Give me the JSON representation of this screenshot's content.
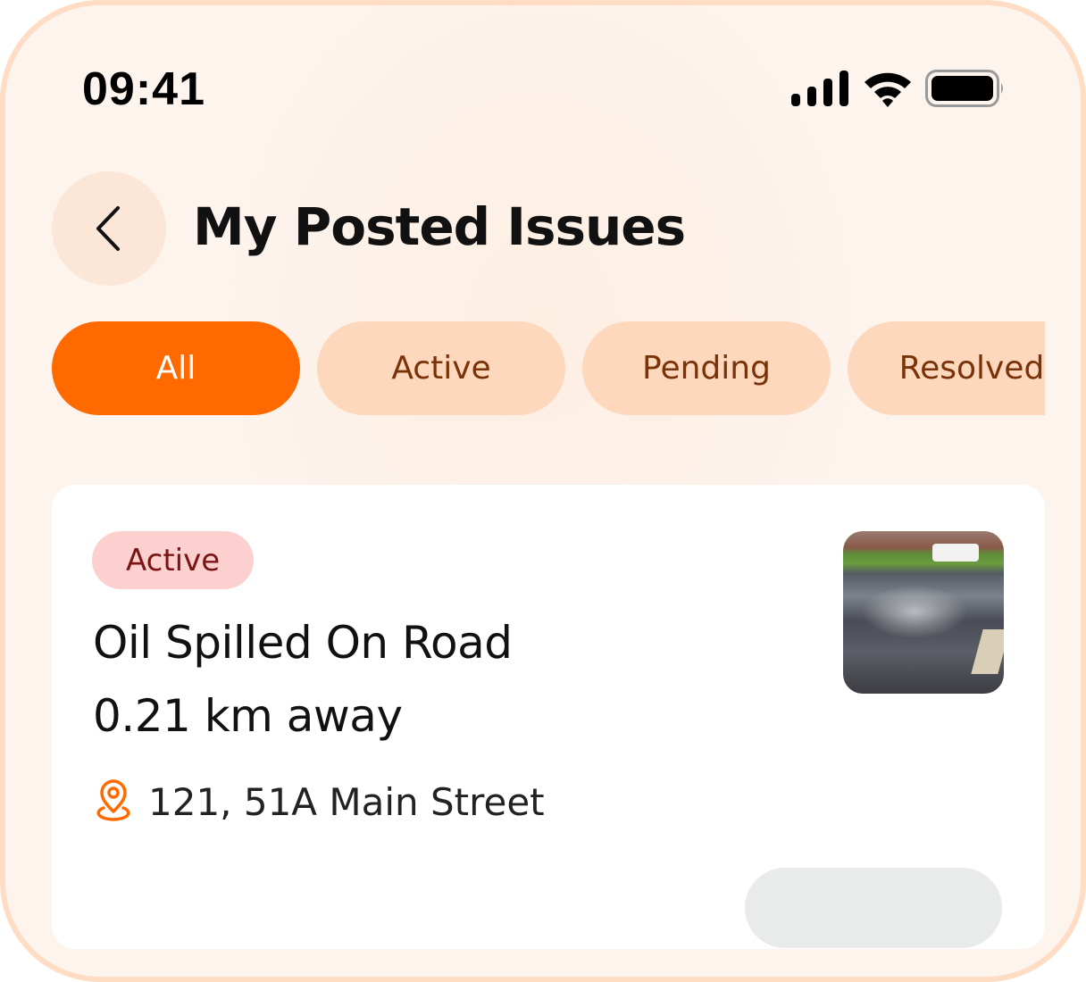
{
  "status_bar": {
    "time": "09:41",
    "icons": [
      "signal-icon",
      "wifi-icon",
      "battery-icon"
    ]
  },
  "header": {
    "title": "My Posted Issues",
    "back_icon": "chevron-left-icon"
  },
  "tabs": [
    {
      "label": "All",
      "selected": true
    },
    {
      "label": "Active",
      "selected": false
    },
    {
      "label": "Pending",
      "selected": false
    },
    {
      "label": "Resolved",
      "selected": false
    }
  ],
  "issues": [
    {
      "status": "Active",
      "title": "Oil Spilled On Road",
      "distance": "0.21 km away",
      "address": "121, 51A Main Street",
      "address_icon": "location-pin-icon"
    }
  ],
  "colors": {
    "accent": "#ff6a00",
    "tab_bg": "#fdd8bd",
    "badge_bg": "#fdd0d0",
    "frame": "#ffdcc3"
  }
}
